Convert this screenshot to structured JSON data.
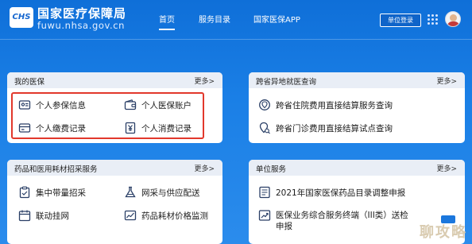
{
  "header": {
    "logo_text": "CHS",
    "site_title": "国家医疗保障局",
    "site_url": "fuwu.nhsa.gov.cn",
    "nav": [
      {
        "label": "首页",
        "active": true
      },
      {
        "label": "服务目录",
        "active": false
      },
      {
        "label": "国家医保APP",
        "active": false
      }
    ],
    "unit_button": "单位登录"
  },
  "cards": {
    "my_insurance": {
      "title": "我的医保",
      "more": "更多>",
      "items": [
        {
          "label": "个人参保信息",
          "icon": "id-card-icon"
        },
        {
          "label": "个人医保账户",
          "icon": "wallet-icon"
        },
        {
          "label": "个人缴费记录",
          "icon": "payment-icon"
        },
        {
          "label": "个人消费记录",
          "icon": "yen-receipt-icon"
        }
      ]
    },
    "cross_province": {
      "title": "跨省异地就医查询",
      "more": "更多>",
      "items": [
        {
          "label": "跨省住院费用直接结算服务查询",
          "icon": "location-search-icon"
        },
        {
          "label": "跨省门诊费用直接结算试点查询",
          "icon": "map-pin-search-icon"
        }
      ]
    },
    "drug_procurement": {
      "title": "药品和医用耗材招采服务",
      "more": "更多>",
      "items": [
        {
          "label": "集中带量招采",
          "icon": "clipboard-icon"
        },
        {
          "label": "网采与供应配送",
          "icon": "flask-icon"
        },
        {
          "label": "联动挂网",
          "icon": "calendar-icon"
        },
        {
          "label": "药品耗材价格监测",
          "icon": "chart-monitor-icon"
        }
      ]
    },
    "unit_services": {
      "title": "单位服务",
      "more": "更多>",
      "items": [
        {
          "label": "2021年国家医保药品目录调整申报",
          "icon": "document-list-icon"
        },
        {
          "label": "医保业务综合服务终端（III类）送检申报",
          "icon": "chart-upload-icon"
        }
      ]
    }
  },
  "watermark": "聊攻略",
  "colors": {
    "accent": "#1667cf",
    "highlight": "#e2382c",
    "icon": "#2a3f66"
  }
}
